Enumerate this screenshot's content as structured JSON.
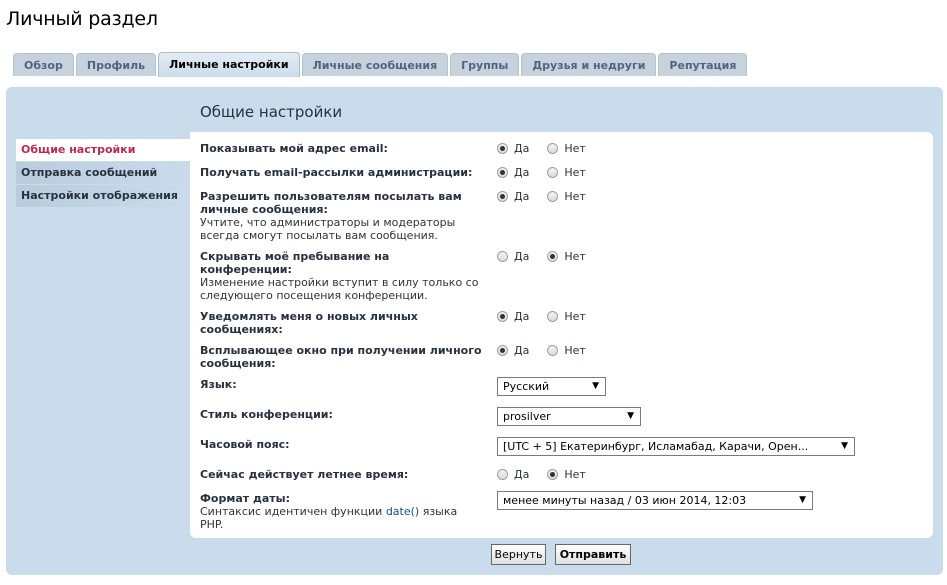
{
  "page": {
    "title": "Личный раздел"
  },
  "tabs": [
    {
      "label": "Обзор"
    },
    {
      "label": "Профиль"
    },
    {
      "label": "Личные настройки",
      "active": true
    },
    {
      "label": "Личные сообщения"
    },
    {
      "label": "Группы"
    },
    {
      "label": "Друзья и недруги"
    },
    {
      "label": "Репутация"
    }
  ],
  "section": {
    "title": "Общие настройки"
  },
  "menu": [
    {
      "label": "Общие настройки",
      "active": true
    },
    {
      "label": "Отправка сообщений"
    },
    {
      "label": "Настройки отображения"
    }
  ],
  "yes_label": "Да",
  "no_label": "Нет",
  "settings": {
    "show_email": {
      "label": "Показывать мой адрес email:",
      "value": "yes"
    },
    "admin_mail": {
      "label": "Получать email-рассылки администрации:",
      "value": "yes"
    },
    "allow_pm": {
      "label": "Разрешить пользователям посылать вам личные сообщения:",
      "desc": "Учтите, что администраторы и модераторы всегда смогут посылать вам сообщения.",
      "value": "yes"
    },
    "hide_online": {
      "label": "Скрывать моё пребывание на конференции:",
      "desc": "Изменение настройки вступит в силу только со следующего посещения конференции.",
      "value": "no"
    },
    "notify_pm": {
      "label": "Уведомлять меня о новых личных сообщениях:",
      "value": "yes"
    },
    "popup_pm": {
      "label": "Всплывающее окно при получении личного сообщения:",
      "value": "yes"
    },
    "language": {
      "label": "Язык:",
      "selected": "Русский"
    },
    "style": {
      "label": "Стиль конференции:",
      "selected": "prosilver"
    },
    "timezone": {
      "label": "Часовой пояс:",
      "selected": "[UTC + 5] Екатеринбург, Исламабад, Карачи, Орен..."
    },
    "dst": {
      "label": "Сейчас действует летнее время:",
      "value": "no"
    },
    "date_format": {
      "label": "Формат даты:",
      "desc_before": "Синтаксис идентичен функции ",
      "desc_fn": "date()",
      "desc_after": " языка PHP.",
      "selected": "менее минуты назад / 03 июн 2014, 12:03"
    }
  },
  "buttons": {
    "reset": "Вернуть",
    "submit": "Отправить"
  },
  "icons": {
    "dropdown": "triangle-down-icon",
    "radio": "radio-icon"
  },
  "colors": {
    "panel": "#cadceb",
    "active_menu_text": "#bc2a4d",
    "text": "#28313f"
  }
}
